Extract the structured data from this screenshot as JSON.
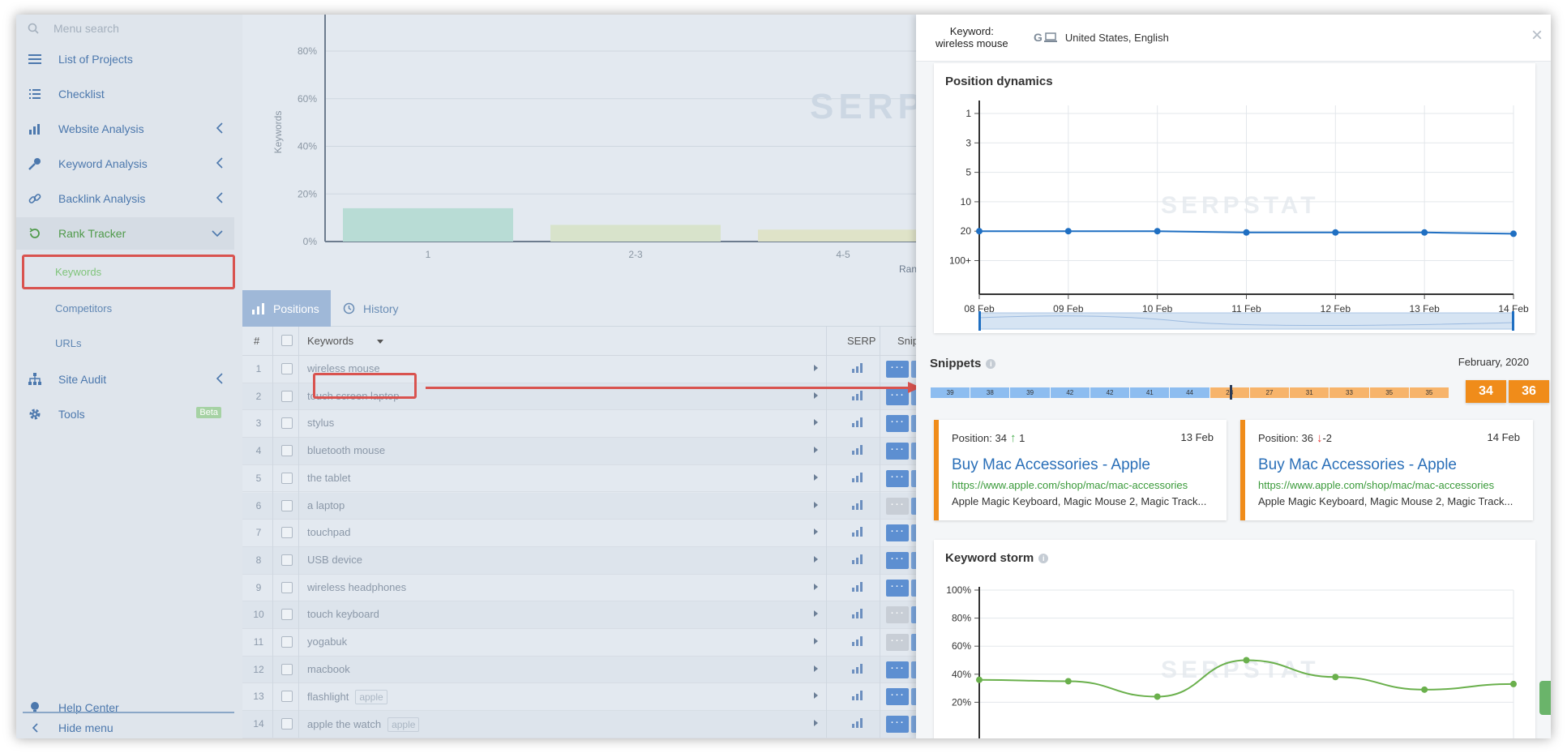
{
  "sidebar": {
    "search_placeholder": "Menu search",
    "items": [
      {
        "label": "List of Projects",
        "icon": "list-icon"
      },
      {
        "label": "Checklist",
        "icon": "checklist-icon"
      },
      {
        "label": "Website Analysis",
        "icon": "chart-icon"
      },
      {
        "label": "Keyword Analysis",
        "icon": "key-icon"
      },
      {
        "label": "Backlink Analysis",
        "icon": "link-icon"
      },
      {
        "label": "Rank Tracker",
        "icon": "refresh-icon"
      },
      {
        "label": "Site Audit",
        "icon": "sitemap-icon"
      },
      {
        "label": "Tools",
        "icon": "gear-icon",
        "badge": "Beta"
      }
    ],
    "rank_sub": [
      "Keywords",
      "Competitors",
      "URLs"
    ],
    "help": "Help Center",
    "hide": "Hide menu"
  },
  "rank_chart": {
    "ylabel": "Keywords",
    "yticks": [
      "80%",
      "60%",
      "40%",
      "20%",
      "0%"
    ],
    "categories": [
      "1",
      "2-3",
      "4-5"
    ],
    "xlabel_partial": "Rankin",
    "watermark": "SERP"
  },
  "tabs": [
    {
      "label": "Positions"
    },
    {
      "label": "History"
    }
  ],
  "table": {
    "headers": {
      "num": "#",
      "keywords": "Keywords",
      "serp": "SERP",
      "snippet": "Snippet"
    },
    "rows": [
      {
        "n": "1",
        "kw": "wireless mouse",
        "tag": "",
        "grey": false
      },
      {
        "n": "2",
        "kw": "touch screen laptop",
        "tag": "",
        "grey": false
      },
      {
        "n": "3",
        "kw": "stylus",
        "tag": "",
        "grey": false
      },
      {
        "n": "4",
        "kw": "bluetooth mouse",
        "tag": "",
        "grey": false
      },
      {
        "n": "5",
        "kw": "the tablet",
        "tag": "",
        "grey": false
      },
      {
        "n": "6",
        "kw": "a laptop",
        "tag": "",
        "grey": true
      },
      {
        "n": "7",
        "kw": "touchpad",
        "tag": "",
        "grey": false
      },
      {
        "n": "8",
        "kw": "USB device",
        "tag": "",
        "grey": false
      },
      {
        "n": "9",
        "kw": "wireless headphones",
        "tag": "",
        "grey": false
      },
      {
        "n": "10",
        "kw": "touch keyboard",
        "tag": "",
        "grey": true
      },
      {
        "n": "11",
        "kw": "yogabuk",
        "tag": "",
        "grey": true
      },
      {
        "n": "12",
        "kw": "macbook",
        "tag": "",
        "grey": false
      },
      {
        "n": "13",
        "kw": "flashlight",
        "tag": "apple",
        "grey": false
      },
      {
        "n": "14",
        "kw": "apple the watch",
        "tag": "apple",
        "grey": false
      }
    ]
  },
  "panel": {
    "keyword_label": "Keyword:",
    "keyword": "wireless mouse",
    "region": "United States, English",
    "close": "×",
    "position_dynamics": {
      "title": "Position dynamics",
      "watermark": "SERPSTAT"
    },
    "snippets": {
      "title": "Snippets",
      "date": "February, 2020",
      "cells": [
        {
          "v": "39",
          "c": "blue"
        },
        {
          "v": "38",
          "c": "blue"
        },
        {
          "v": "39",
          "c": "blue"
        },
        {
          "v": "42",
          "c": "blue"
        },
        {
          "v": "42",
          "c": "blue"
        },
        {
          "v": "41",
          "c": "blue"
        },
        {
          "v": "44",
          "c": "blue"
        },
        {
          "v": "28",
          "c": "orange"
        },
        {
          "v": "27",
          "c": "orange"
        },
        {
          "v": "31",
          "c": "orange"
        },
        {
          "v": "33",
          "c": "orange"
        },
        {
          "v": "35",
          "c": "orange"
        },
        {
          "v": "35",
          "c": "orange"
        }
      ],
      "highlight": [
        "34",
        "36"
      ],
      "cards": [
        {
          "position": "Position: 34",
          "change": "1",
          "dir": "up",
          "date": "13 Feb",
          "title": "Buy Mac Accessories - Apple",
          "url": "https://www.apple.com/shop/mac/mac-accessories",
          "desc": "Apple Magic Keyboard, Magic Mouse 2, Magic Track..."
        },
        {
          "position": "Position: 36",
          "change": "-2",
          "dir": "down",
          "date": "14 Feb",
          "title": "Buy Mac Accessories - Apple",
          "url": "https://www.apple.com/shop/mac/mac-accessories",
          "desc": "Apple Magic Keyboard, Magic Mouse 2, Magic Track..."
        }
      ]
    },
    "keyword_storm": {
      "title": "Keyword storm",
      "watermark": "SERPSTAT"
    }
  },
  "colors": {
    "accent": "#4c78ad",
    "orange": "#f08c1a",
    "red_highlight": "#d9534f",
    "line_blue": "#1f6fc2",
    "line_green": "#6ab04c"
  },
  "chart_data": [
    {
      "type": "bar",
      "categories": [
        "1",
        "2-3",
        "4-5"
      ],
      "values": [
        14,
        7,
        5
      ],
      "ylabel": "Keywords",
      "ylim": [
        0,
        90
      ]
    },
    {
      "type": "line",
      "title": "Position dynamics",
      "x": [
        "08 Feb",
        "09 Feb",
        "10 Feb",
        "11 Feb",
        "12 Feb",
        "13 Feb",
        "14 Feb"
      ],
      "yticks": [
        "1",
        "3",
        "5",
        "10",
        "20",
        "100+"
      ],
      "y": [
        20,
        20,
        20,
        21,
        21,
        21,
        22
      ],
      "y_reversed": true
    },
    {
      "type": "line",
      "title": "Keyword storm",
      "yticks": [
        "100%",
        "80%",
        "60%",
        "40%",
        "20%"
      ],
      "y": [
        36,
        35,
        24,
        50,
        38,
        29,
        33
      ],
      "ylim": [
        15,
        100
      ]
    }
  ]
}
